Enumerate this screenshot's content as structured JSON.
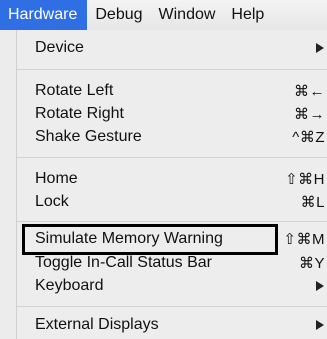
{
  "menubar": {
    "items": [
      {
        "label": "Hardware"
      },
      {
        "label": "Debug"
      },
      {
        "label": "Window"
      },
      {
        "label": "Help"
      }
    ]
  },
  "dropdown": {
    "items": [
      {
        "label": "Device",
        "shortcut": "",
        "submenu": true
      },
      {
        "label": "Rotate Left",
        "shortcut": "⌘←"
      },
      {
        "label": "Rotate Right",
        "shortcut": "⌘→"
      },
      {
        "label": "Shake Gesture",
        "shortcut": "^⌘Z"
      },
      {
        "label": "Home",
        "shortcut": "⇧⌘H"
      },
      {
        "label": "Lock",
        "shortcut": "⌘L"
      },
      {
        "label": "Simulate Memory Warning",
        "shortcut": "⇧⌘M"
      },
      {
        "label": "Toggle In-Call Status Bar",
        "shortcut": "⌘Y"
      },
      {
        "label": "Keyboard",
        "shortcut": "",
        "submenu": true
      },
      {
        "label": "External Displays",
        "shortcut": "",
        "submenu": true
      }
    ]
  },
  "colors": {
    "accent": "#2f6fe3",
    "highlight_border": "#000000"
  }
}
